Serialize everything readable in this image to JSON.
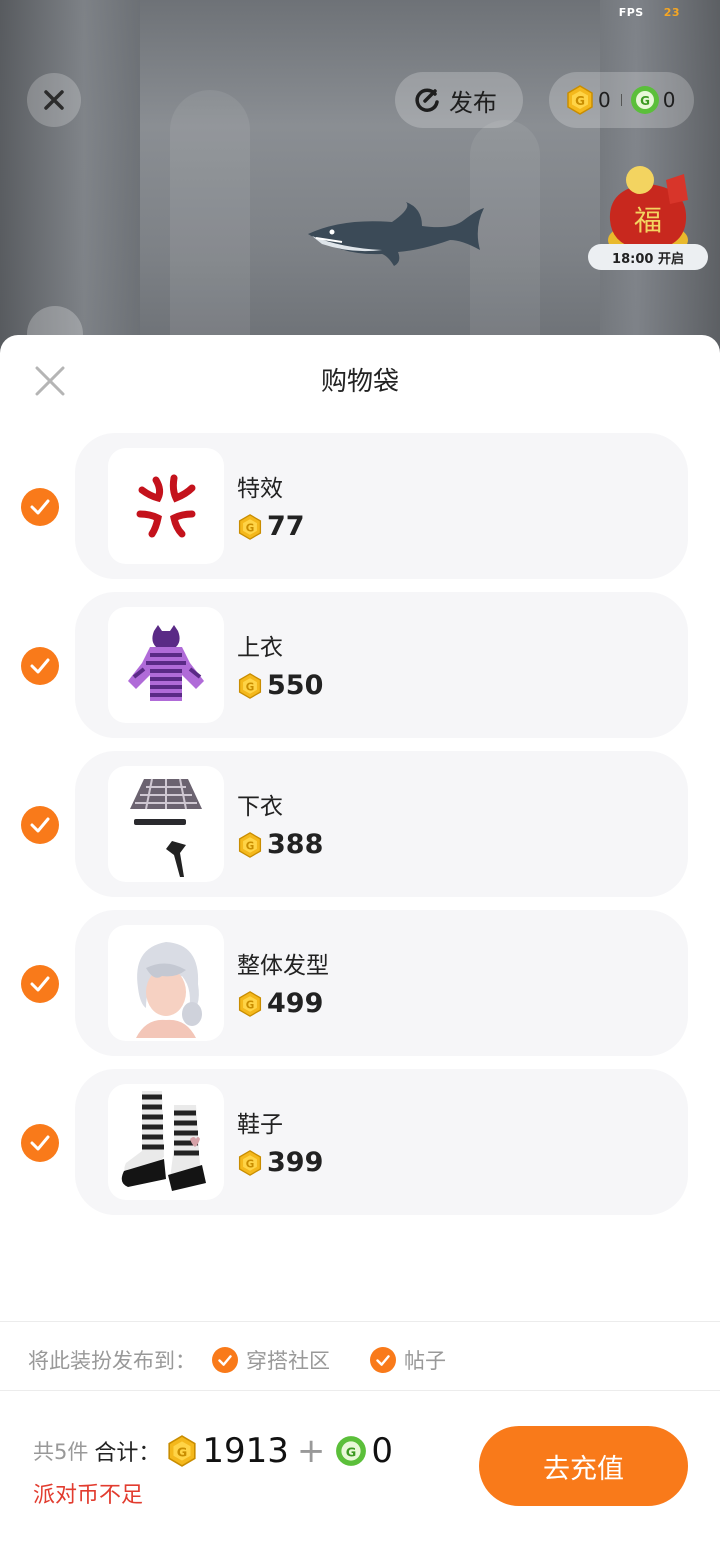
{
  "status": {
    "fps_label": "FPS",
    "fps_value": "23"
  },
  "top_bar": {
    "publish_label": "发布",
    "gold_coin_count": "0",
    "green_coin_count": "0"
  },
  "event": {
    "timer_label": "18:00 开启"
  },
  "sheet": {
    "title": "购物袋",
    "items": [
      {
        "name": "特效",
        "price": "77",
        "selected": true,
        "icon": "anger-mark-icon"
      },
      {
        "name": "上衣",
        "price": "550",
        "selected": true,
        "icon": "purple-striped-hoodie"
      },
      {
        "name": "下衣",
        "price": "388",
        "selected": true,
        "icon": "plaid-skirt"
      },
      {
        "name": "整体发型",
        "price": "499",
        "selected": true,
        "icon": "silver-hair"
      },
      {
        "name": "鞋子",
        "price": "399",
        "selected": true,
        "icon": "striped-boots"
      }
    ],
    "publish_to_label": "将此装扮发布到：",
    "publish_options": [
      "穿搭社区",
      "帖子"
    ],
    "summary": {
      "count_label": "共5件",
      "total_label": "合计：",
      "gold_total": "1913",
      "plus": "+",
      "green_total": "0"
    },
    "warning": "派对币不足",
    "recharge_label": "去充值"
  },
  "colors": {
    "accent": "#f97a1a",
    "warning": "#e23c2f",
    "gold_coin": "#f4b81c",
    "green_coin": "#5bbf3a"
  }
}
